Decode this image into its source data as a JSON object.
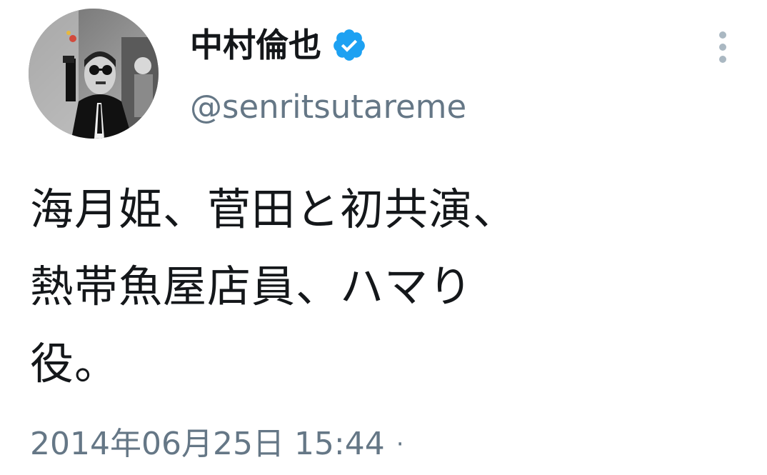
{
  "tweet": {
    "author": {
      "display_name": "中村倫也",
      "handle": "@senritsutareme",
      "verified": true,
      "avatar_icon": "avatar-photo-icon",
      "verified_color": "#1da1f2"
    },
    "more_icon": "more-vertical-icon",
    "text": "海月姫、菅田と初共演、\n熱帯魚屋店員、ハマり\n役。",
    "timestamp": "2014年06月25日 15:44",
    "separator": "·"
  },
  "colors": {
    "text": "#14171a",
    "secondary": "#657786",
    "icon_grey": "#aab8c2"
  }
}
